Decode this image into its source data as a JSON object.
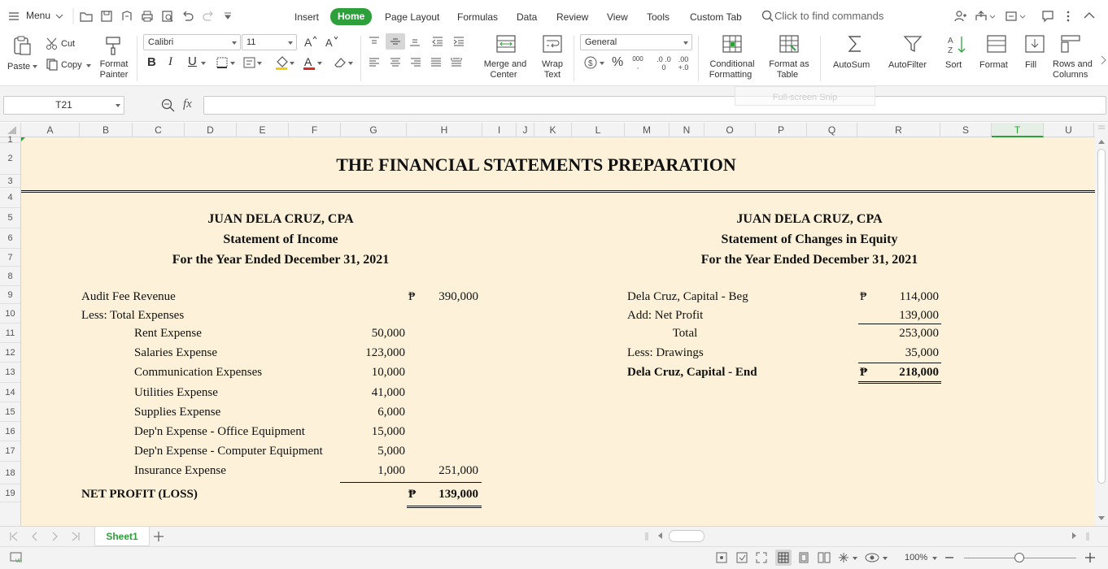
{
  "menubar": {
    "menu_label": "Menu",
    "tabs": [
      "Insert",
      "Home",
      "Page Layout",
      "Formulas",
      "Data",
      "Review",
      "View",
      "Tools",
      "Custom Tab"
    ],
    "active_tab": "Home",
    "search_placeholder": "Click to find commands"
  },
  "ribbon": {
    "paste": "Paste",
    "cut": "Cut",
    "copy": "Copy",
    "format_painter": [
      "Format",
      "Painter"
    ],
    "font_name": "Calibri",
    "font_size": "11",
    "number_format": "General",
    "merge": [
      "Merge and",
      "Center"
    ],
    "wrap": [
      "Wrap",
      "Text"
    ],
    "conditional": [
      "Conditional",
      "Formatting"
    ],
    "format_table": [
      "Format as",
      "Table"
    ],
    "autosum": "AutoSum",
    "autofilter": "AutoFilter",
    "sort": "Sort",
    "format": "Format",
    "fill": "Fill",
    "rows_cols": [
      "Rows and",
      "Columns"
    ],
    "bold": "B",
    "italic": "I",
    "underline": "U",
    "percent": "%",
    "thousands": "000",
    "inc_dec": ".0 .00",
    "dec_dec": ".00 +.0"
  },
  "formula_bar": {
    "name_box": "T21",
    "fx": "fx",
    "overlay": "Full-screen Snip",
    "formula": ""
  },
  "columns": [
    "A",
    "B",
    "C",
    "D",
    "E",
    "F",
    "G",
    "H",
    "I",
    "J",
    "K",
    "L",
    "M",
    "N",
    "O",
    "P",
    "Q",
    "R",
    "S",
    "T",
    "U"
  ],
  "selected_column": "T",
  "rows": [
    "1",
    "2",
    "3",
    "4",
    "5",
    "6",
    "7",
    "8",
    "9",
    "10",
    "11",
    "12",
    "13",
    "14",
    "15",
    "16",
    "17",
    "18",
    "19"
  ],
  "sheet": {
    "title": "THE FINANCIAL STATEMENTS PREPARATION",
    "income": {
      "company": "JUAN DELA CRUZ, CPA",
      "statement": "Statement of Income",
      "period": "For the Year Ended December 31, 2021",
      "revenue_label": "Audit Fee Revenue",
      "peso": "₱",
      "revenue_value": "390,000",
      "less_label": "Less: Total Expenses",
      "expenses": [
        {
          "label": "Rent Expense",
          "value": "50,000"
        },
        {
          "label": "Salaries Expense",
          "value": "123,000"
        },
        {
          "label": "Communication Expenses",
          "value": "10,000"
        },
        {
          "label": "Utilities Expense",
          "value": "41,000"
        },
        {
          "label": "Supplies Expense",
          "value": "6,000"
        },
        {
          "label": "Dep'n Expense - Office Equipment",
          "value": "15,000"
        },
        {
          "label": "Dep'n Expense - Computer Equipment",
          "value": "5,000"
        },
        {
          "label": "Insurance Expense",
          "value": "1,000"
        }
      ],
      "total_expenses": "251,000",
      "net_label": "NET PROFIT (LOSS)",
      "net_value": "139,000"
    },
    "equity": {
      "company": "JUAN DELA CRUZ, CPA",
      "statement": "Statement of Changes in Equity",
      "period": "For the Year Ended December 31, 2021",
      "beg_label": "Dela Cruz, Capital - Beg",
      "beg_value": "114,000",
      "add_label": "Add: Net Profit",
      "add_value": "139,000",
      "total_label": "Total",
      "total_value": "253,000",
      "less_label": "Less: Drawings",
      "less_value": "35,000",
      "end_label": "Dela Cruz, Capital - End",
      "end_value": "218,000"
    }
  },
  "sheet_tabs": [
    "Sheet1"
  ],
  "status": {
    "zoom": "100%"
  },
  "colors": {
    "accent": "#2ea03b",
    "sheet_bg": "#fdf2d9"
  }
}
